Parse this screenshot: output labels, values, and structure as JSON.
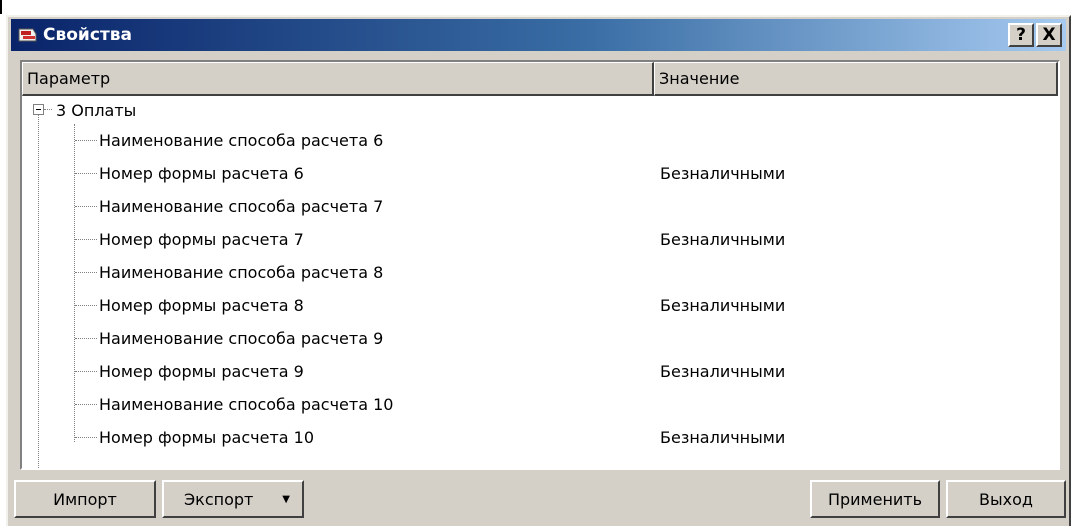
{
  "window": {
    "title": "Свойства",
    "help_label": "?",
    "close_label": "X"
  },
  "grid": {
    "columns": [
      "Параметр",
      "Значение"
    ],
    "root_label": "3 Оплаты",
    "rows": [
      {
        "name": "Наименование способа расчета 6",
        "value": ""
      },
      {
        "name": "Номер формы расчета 6",
        "value": "Безналичными"
      },
      {
        "name": "Наименование способа расчета 7",
        "value": ""
      },
      {
        "name": "Номер формы расчета 7",
        "value": "Безналичными"
      },
      {
        "name": "Наименование способа расчета 8",
        "value": ""
      },
      {
        "name": "Номер формы расчета 8",
        "value": "Безналичными"
      },
      {
        "name": "Наименование способа расчета 9",
        "value": ""
      },
      {
        "name": "Номер формы расчета 9",
        "value": "Безналичными"
      },
      {
        "name": "Наименование способа расчета 10",
        "value": ""
      },
      {
        "name": "Номер формы расчета 10",
        "value": "Безналичными"
      }
    ]
  },
  "buttons": {
    "import": "Импорт",
    "export": "Экспорт",
    "export_arrow": "▼",
    "apply": "Применить",
    "exit": "Выход"
  }
}
